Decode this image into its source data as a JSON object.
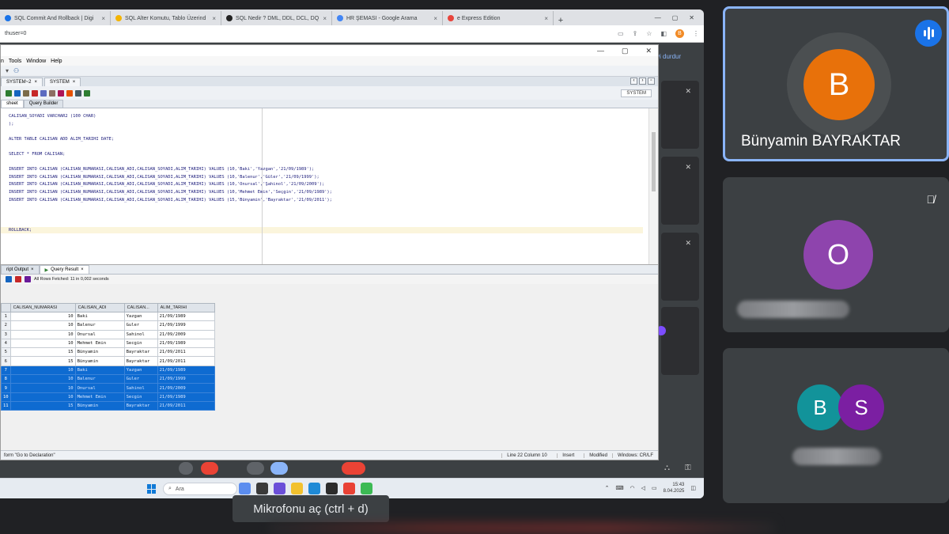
{
  "browser": {
    "tabs": [
      {
        "label": "e Express Edition",
        "fav": "#e8453c"
      },
      {
        "label": "HR ŞEMASI - Google Arama",
        "fav": "#4285f4"
      },
      {
        "label": "SQL Nedir ? DML, DDL, DCL, DQ",
        "fav": "#222222"
      },
      {
        "label": "SQL Alter Komutu, Tablo Üzerind",
        "fav": "#f4b400"
      },
      {
        "label": "SQL Commit And Rollback | Digi",
        "fav": "#1a73e8"
      }
    ],
    "url": "thuser=0",
    "profile_initial": "B"
  },
  "meet": {
    "pause_label": "yi durdur",
    "tooltip": "Mikrofonu aç (ctrl + d)",
    "participants": {
      "main": {
        "name": "Bünyamin BAYRAKTAR",
        "initial": "B",
        "color": "#e8710a"
      },
      "p2": {
        "initial": "O",
        "color": "#8e44ad"
      },
      "p3a": {
        "initial": "B",
        "color": "#12939a"
      },
      "p3b": {
        "initial": "S",
        "color": "#7b1fa2"
      }
    }
  },
  "sql": {
    "menu": [
      "n",
      "Tools",
      "Window",
      "Help"
    ],
    "doc_tabs": [
      "SYSTEM~2",
      "SYSTEM"
    ],
    "connection": "SYSTEM",
    "sub_tabs": [
      "sheet",
      "Query Builder"
    ],
    "code_lines": [
      "CALISAN_SOYADI VARCHAR2 (100 CHAR)",
      ");",
      "",
      "ALTER TABLE CALISAN ADD ALIM_TARIHI DATE;",
      "",
      "SELECT * FROM CALISAN;",
      "",
      "INSERT INTO CALISAN (CALISAN_NUMARASI,CALISAN_ADI,CALISAN_SOYADI,ALIM_TARIHI) VALUES (10,'Baki','Yazgan','21/09/1989');",
      "INSERT INTO CALISAN (CALISAN_NUMARASI,CALISAN_ADI,CALISAN_SOYADI,ALIM_TARIHI) VALUES (10,'Balenur','Güler','21/09/1999');",
      "INSERT INTO CALISAN (CALISAN_NUMARASI,CALISAN_ADI,CALISAN_SOYADI,ALIM_TARIHI) VALUES (10,'Onursal','Şahinol','21/09/2009');",
      "INSERT INTO CALISAN (CALISAN_NUMARASI,CALISAN_ADI,CALISAN_SOYADI,ALIM_TARIHI) VALUES (10,'Mehmet Emin','Seçgin','21/09/1989');",
      "INSERT INTO CALISAN (CALISAN_NUMARASI,CALISAN_ADI,CALISAN_SOYADI,ALIM_TARIHI) VALUES (15,'Bünyamin','Bayraktar','21/09/2011');",
      "",
      "",
      "",
      "ROLLBACK;"
    ],
    "output_tabs": [
      "ript Output",
      "Query Result"
    ],
    "fetch_status": "All Rows Fetched: 11 in 0,002 seconds",
    "columns": [
      "CALISAN_NUMARASI",
      "CALISAN_ADI",
      "CALISAN...",
      "ALIM_TARIHI"
    ],
    "rows": [
      {
        "n": "1",
        "num": "10",
        "adi": "Baki",
        "soyadi": "Yazgan",
        "tarih": "21/09/1989",
        "sel": false
      },
      {
        "n": "2",
        "num": "10",
        "adi": "Balenur",
        "soyadi": "Guler",
        "tarih": "21/09/1999",
        "sel": false
      },
      {
        "n": "3",
        "num": "10",
        "adi": "Onursal",
        "soyadi": "Sahinol",
        "tarih": "21/09/2009",
        "sel": false
      },
      {
        "n": "4",
        "num": "10",
        "adi": "Mehmet Emin",
        "soyadi": "Secgin",
        "tarih": "21/09/1989",
        "sel": false
      },
      {
        "n": "5",
        "num": "15",
        "adi": "Bünyamin",
        "soyadi": "Bayraktar",
        "tarih": "21/09/2011",
        "sel": false
      },
      {
        "n": "6",
        "num": "15",
        "adi": "Bünyamin",
        "soyadi": "Bayraktar",
        "tarih": "21/09/2011",
        "sel": false
      },
      {
        "n": "7",
        "num": "10",
        "adi": "Baki",
        "soyadi": "Yazgan",
        "tarih": "21/09/1989",
        "sel": true
      },
      {
        "n": "8",
        "num": "10",
        "adi": "Balenur",
        "soyadi": "Guler",
        "tarih": "21/09/1999",
        "sel": true
      },
      {
        "n": "9",
        "num": "10",
        "adi": "Onursal",
        "soyadi": "Sahinol",
        "tarih": "21/09/2009",
        "sel": true
      },
      {
        "n": "10",
        "num": "10",
        "adi": "Mehmet Emin",
        "soyadi": "Secgin",
        "tarih": "21/09/1989",
        "sel": true
      },
      {
        "n": "11",
        "num": "15",
        "adi": "Bünyamin",
        "soyadi": "Bayraktar",
        "tarih": "21/09/2011",
        "sel": true
      }
    ],
    "status": {
      "left": "form \"Go to Declaration\"",
      "position": "Line 22 Column 10",
      "mode": "Insert",
      "modified": "Modified",
      "eol": "Windows: CR/LF"
    }
  },
  "taskbar": {
    "search_placeholder": "Ara",
    "time": "15:43",
    "date": "8.04.2025"
  }
}
